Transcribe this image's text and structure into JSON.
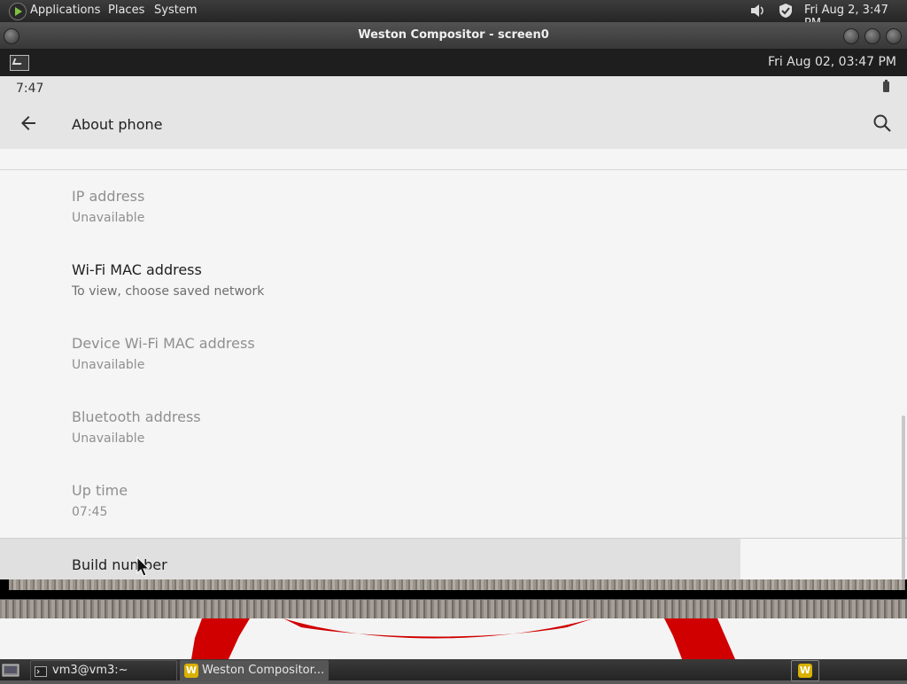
{
  "top_panel": {
    "menus": [
      "Applications",
      "Places",
      "System"
    ],
    "clock": "Fri Aug  2,  3:47 PM",
    "icons": [
      "distro-icon",
      "volume-icon",
      "shield-icon"
    ]
  },
  "window": {
    "title": "Weston Compositor - screen0"
  },
  "weston_panel": {
    "clock": "Fri Aug 02, 03:47 PM",
    "launcher_icon": "terminal-icon"
  },
  "android": {
    "status_time": "7:47",
    "appbar_title": "About phone",
    "prefs": [
      {
        "title": "IP address",
        "summary": "Unavailable",
        "enabled": false
      },
      {
        "title": "Wi-Fi MAC address",
        "summary": "To view, choose saved network",
        "enabled": true
      },
      {
        "title": "Device Wi-Fi MAC address",
        "summary": "Unavailable",
        "enabled": false
      },
      {
        "title": "Bluetooth address",
        "summary": "Unavailable",
        "enabled": false
      },
      {
        "title": "Up time",
        "summary": "07:45",
        "enabled": false
      },
      {
        "title": "Build number",
        "summary": "",
        "enabled": true,
        "pressed": true
      }
    ]
  },
  "taskbar": {
    "tasks": [
      {
        "label": "vm3@vm3:~",
        "icon": "terminal-icon"
      },
      {
        "label": "Weston Compositor...",
        "icon": "weston-icon",
        "active": true
      }
    ]
  },
  "colors": {
    "android_bg": "#f5f5f5",
    "appbar_bg": "#e5e5e5",
    "desktop_red": "#d00000"
  }
}
